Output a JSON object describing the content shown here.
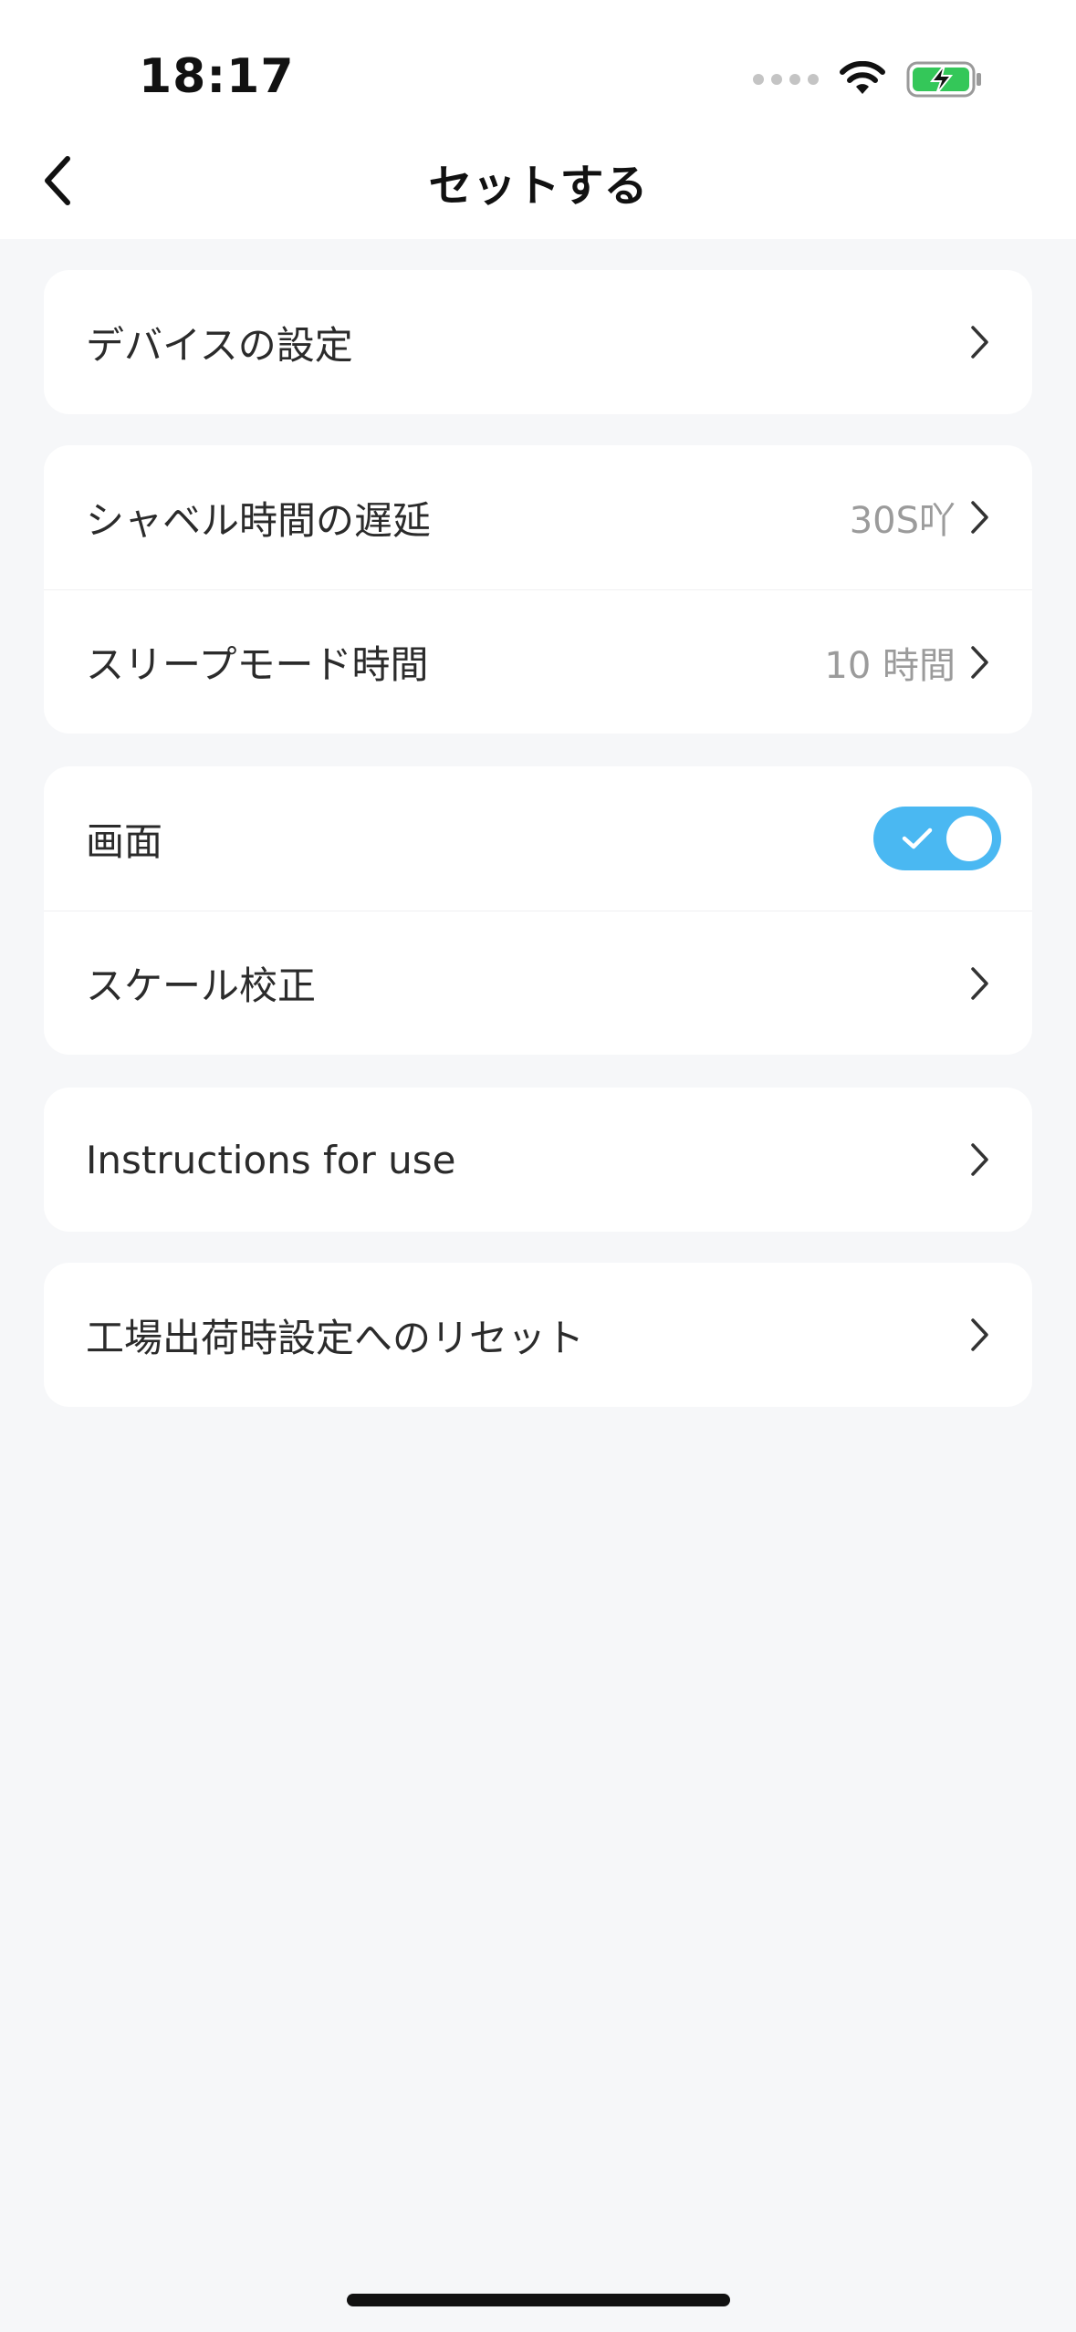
{
  "status_bar": {
    "time": "18:17",
    "icons": [
      "cellular-signal-icon",
      "wifi-icon",
      "battery-charging-icon"
    ]
  },
  "nav": {
    "back_icon": "chevron-left-icon",
    "title": "セットする"
  },
  "groups": [
    {
      "rows": [
        {
          "label": "デバイスの設定",
          "value": "",
          "control": "chevron"
        }
      ]
    },
    {
      "rows": [
        {
          "label": "シャベル時間の遅延",
          "value": "30S吖",
          "control": "chevron"
        },
        {
          "label": "スリープモード時間",
          "value": "10 時間",
          "control": "chevron"
        }
      ]
    },
    {
      "rows": [
        {
          "label": "画面",
          "value": "",
          "control": "toggle",
          "toggle_on": true
        },
        {
          "label": "スケール校正",
          "value": "",
          "control": "chevron"
        }
      ]
    },
    {
      "rows": [
        {
          "label": "Instructions for use",
          "value": "",
          "control": "chevron"
        }
      ]
    },
    {
      "rows": [
        {
          "label": "工場出荷時設定へのリセット",
          "value": "",
          "control": "chevron"
        }
      ]
    }
  ],
  "colors": {
    "background": "#f6f7f9",
    "card": "#ffffff",
    "accent_toggle": "#4ab8f2",
    "secondary_text": "#9b9b9b",
    "battery_green": "#34c759"
  }
}
